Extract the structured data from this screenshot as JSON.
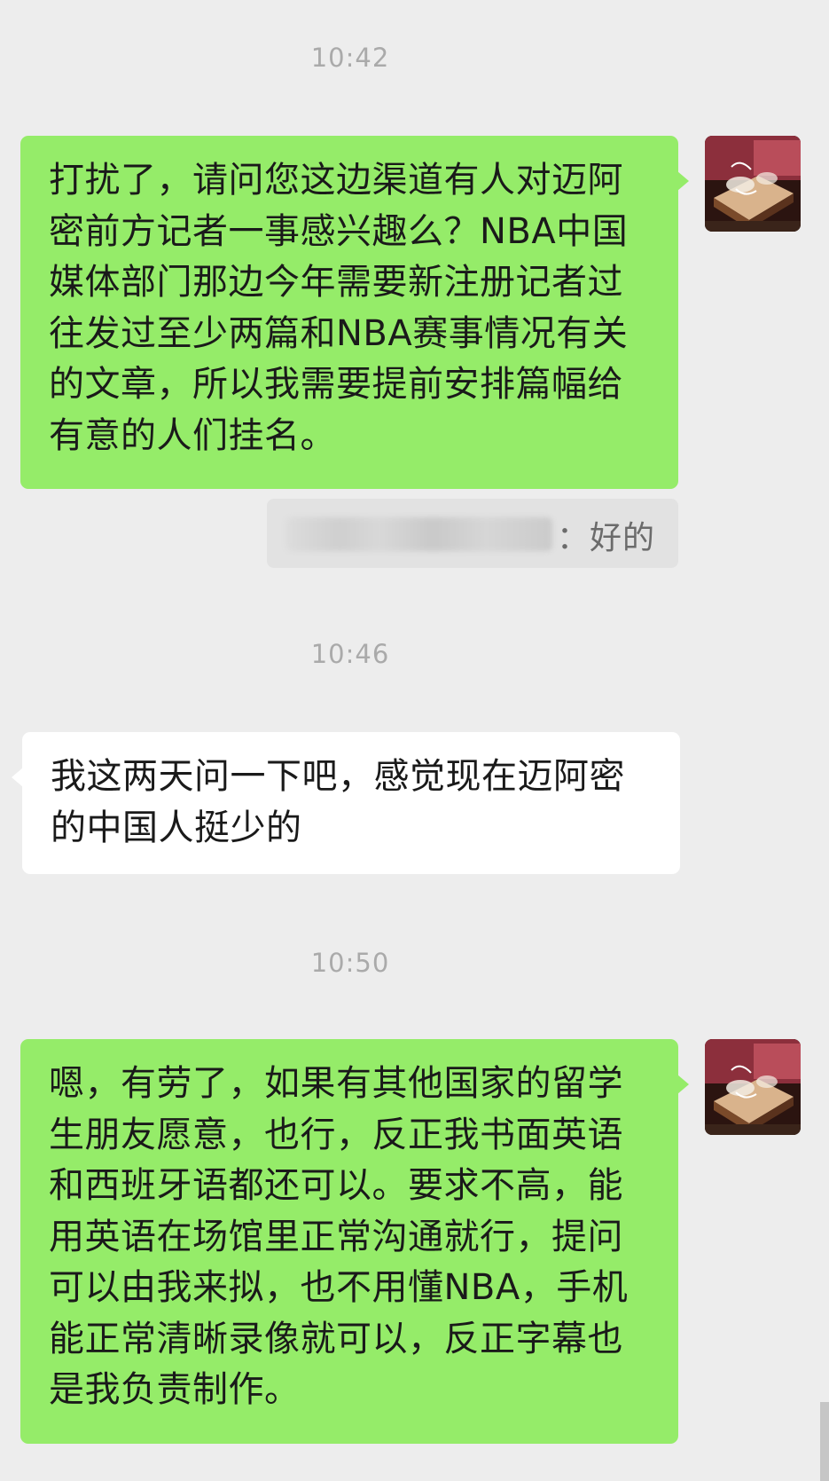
{
  "chat": {
    "time1": "10:42",
    "msg1": "打扰了，请问您这边渠道有人对迈阿密前方记者一事感兴趣么？NBA中国媒体部门那边今年需要新注册记者过往发过至少两篇和NBA赛事情况有关的文章，所以我需要提前安排篇幅给有意的人们挂名。",
    "quote_text": "：好的",
    "time2": "10:46",
    "msg2": "我这两天问一下吧，感觉现在迈阿密的中国人挺少的",
    "time3": "10:50",
    "msg3": "嗯，有劳了，如果有其他国家的留学生朋友愿意，也行，反正我书面英语和西班牙语都还可以。要求不高，能用英语在场馆里正常沟通就行，提问可以由我来拟，也不用懂NBA，手机能正常清晰录像就可以，反正字幕也是我负责制作。"
  },
  "colors": {
    "background": "#ededed",
    "outgoing_bubble": "#95ec69",
    "incoming_bubble": "#ffffff",
    "timestamp": "#aaaaaa"
  },
  "icons": {
    "sender_avatar": "cake-photo-avatar"
  }
}
